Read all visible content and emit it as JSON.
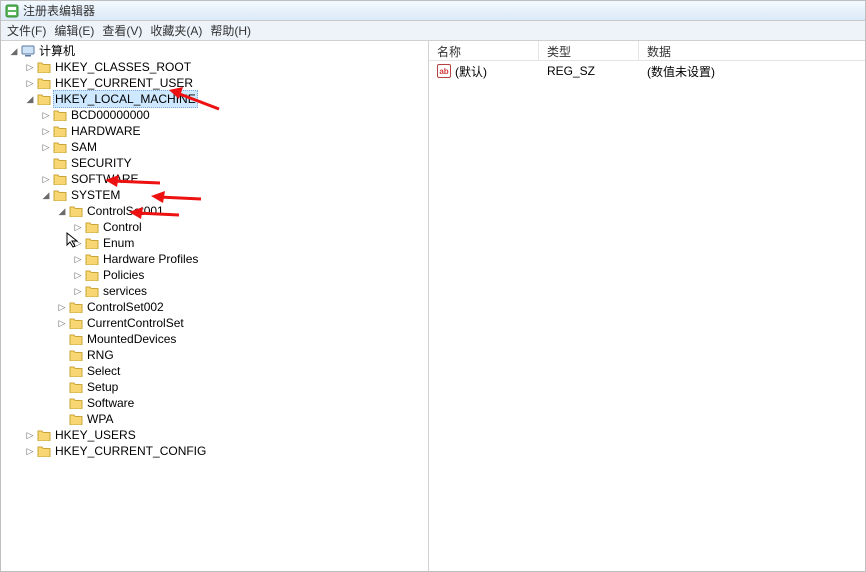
{
  "window": {
    "title": "注册表编辑器"
  },
  "menu": {
    "file": "文件(F)",
    "edit": "编辑(E)",
    "view": "查看(V)",
    "fav": "收藏夹(A)",
    "help": "帮助(H)"
  },
  "columns": {
    "name": "名称",
    "type": "类型",
    "data": "数据"
  },
  "values": [
    {
      "name": "(默认)",
      "type": "REG_SZ",
      "data": "(数值未设置)"
    }
  ],
  "tree": {
    "root": "计算机",
    "hkcr": "HKEY_CLASSES_ROOT",
    "hkcu": "HKEY_CURRENT_USER",
    "hklm": "HKEY_LOCAL_MACHINE",
    "hklm_children": {
      "bcd": "BCD00000000",
      "hardware": "HARDWARE",
      "sam": "SAM",
      "security": "SECURITY",
      "software": "SOFTWARE",
      "system": "SYSTEM"
    },
    "system_children": {
      "cs001": "ControlSet001",
      "cs002": "ControlSet002",
      "ccs": "CurrentControlSet",
      "mounted": "MountedDevices",
      "rng": "RNG",
      "select": "Select",
      "setup": "Setup",
      "software2": "Software",
      "wpa": "WPA"
    },
    "cs001_children": {
      "control": "Control",
      "enum": "Enum",
      "hwprof": "Hardware Profiles",
      "policies": "Policies",
      "services": "services"
    },
    "hku": "HKEY_USERS",
    "hkcc": "HKEY_CURRENT_CONFIG"
  }
}
